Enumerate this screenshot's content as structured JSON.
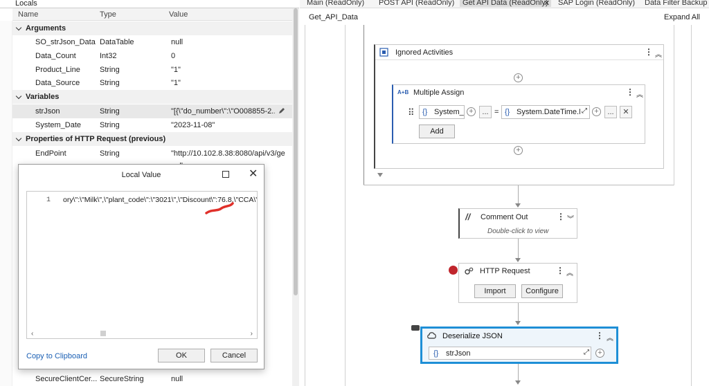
{
  "locals": {
    "title": "Locals",
    "columns": {
      "name": "Name",
      "type": "Type",
      "value": "Value"
    },
    "sections": [
      {
        "label": "Arguments"
      },
      {
        "label": "Variables"
      },
      {
        "label": "Properties of HTTP Request (previous)"
      }
    ],
    "rows": [
      {
        "name": "SO_strJson_Data",
        "type": "DataTable",
        "value": "null"
      },
      {
        "name": "Data_Count",
        "type": "Int32",
        "value": "0"
      },
      {
        "name": "Product_Line",
        "type": "String",
        "value": "\"1\""
      },
      {
        "name": "Data_Source",
        "type": "String",
        "value": "\"1\""
      },
      {
        "name": "strJson",
        "type": "String",
        "value": "\"[{\\\"do_number\\\":\\\"O008855-2..."
      },
      {
        "name": "System_Date",
        "type": "String",
        "value": "\"2023-11-08\""
      },
      {
        "name": "EndPoint",
        "type": "String",
        "value": "\"http://10.102.8.38:8080/api/v3/ge"
      },
      {
        "name": "",
        "type": "",
        "value": "null"
      },
      {
        "name": "SecureClientCer...",
        "type": "SecureString",
        "value": "null"
      }
    ]
  },
  "dialog": {
    "title": "Local Value",
    "line_number": "1",
    "code_text": "ory\\\":\\\"Milk\\\",\\\"plant_code\\\":\\\"3021\\\",\\\"Discount\\\":76.8,\\\"CCA\\\":\\\"",
    "copy_label": "Copy to Clipboard",
    "ok_label": "OK",
    "cancel_label": "Cancel",
    "annotation_color": "#e0302a"
  },
  "tabs": [
    {
      "label": "Main (ReadOnly)"
    },
    {
      "label": "POST API (ReadOnly)"
    },
    {
      "label": "Get API Data (ReadOnly)"
    },
    {
      "label": "SAP Login (ReadOnly)"
    },
    {
      "label": "Data Filter Backup (R"
    }
  ],
  "designer": {
    "breadcrumb": "Get_API_Data",
    "expand_all": "Expand All",
    "ignored_activities": {
      "title": "Ignored Activities"
    },
    "multiple_assign": {
      "title": "Multiple Assign",
      "to_field": "System_D",
      "value_field": "System.DateTime.N",
      "equals": "=",
      "add_label": "Add",
      "ellipsis": "..."
    },
    "comment_out": {
      "title": "Comment Out",
      "hint": "Double-click to view"
    },
    "http_request": {
      "title": "HTTP Request",
      "import_label": "Import",
      "configure_label": "Configure",
      "breakpoint_color": "#c0262d"
    },
    "deserialize_json": {
      "title": "Deserialize JSON",
      "input": "strJson",
      "accent": "#1e8fd6"
    }
  }
}
